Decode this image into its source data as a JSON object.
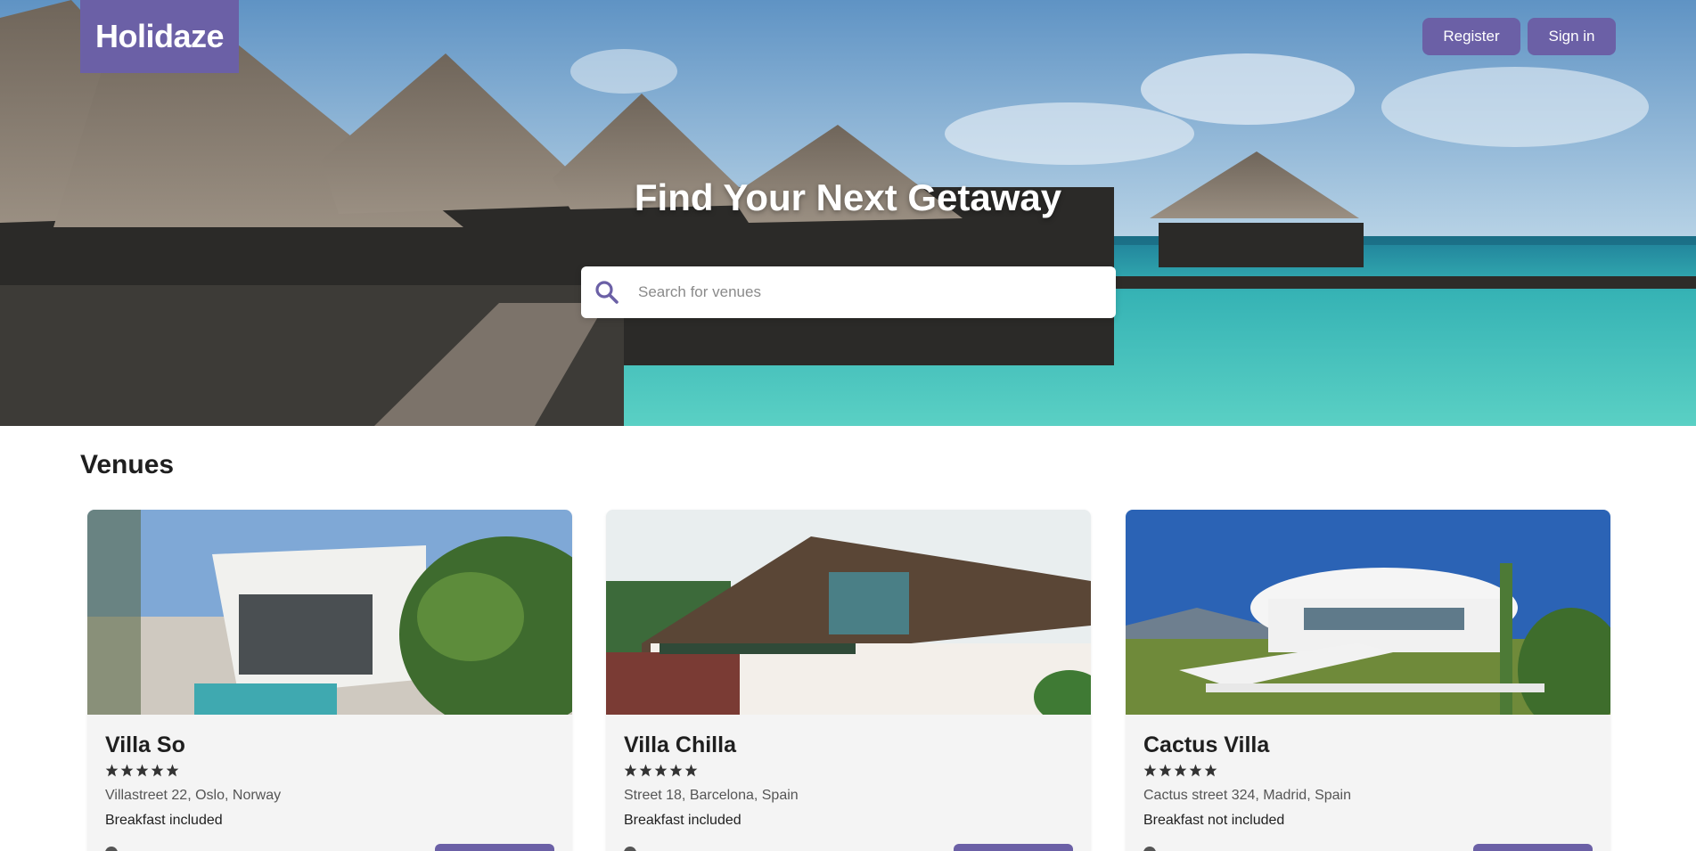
{
  "header": {
    "logo_text": "Holidaze",
    "register_label": "Register",
    "signin_label": "Sign in"
  },
  "hero": {
    "title": "Find Your Next Getaway",
    "search": {
      "icon": "search-icon",
      "placeholder": "Search for venues",
      "value": ""
    }
  },
  "venues": {
    "heading": "Venues",
    "items": [
      {
        "name": "Villa So",
        "rating": 5,
        "address": "Villastreet 22, Oslo, Norway",
        "breakfast": "Breakfast included"
      },
      {
        "name": "Villa Chilla",
        "rating": 5,
        "address": "Street 18, Barcelona, Spain",
        "breakfast": "Breakfast included"
      },
      {
        "name": "Cactus Villa",
        "rating": 5,
        "address": "Cactus street 324, Madrid, Spain",
        "breakfast": "Breakfast not included"
      }
    ]
  },
  "colors": {
    "brand": "#6b60a6",
    "card_bg": "#f4f4f4",
    "text": "#1f1f1f",
    "muted_text": "#555555"
  }
}
